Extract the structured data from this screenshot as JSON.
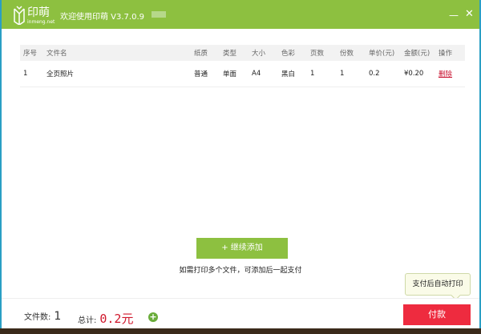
{
  "window": {
    "logo_text": "印萌",
    "logo_sub": "inmeng.net",
    "title": "欢迎使用印萌 V3.7.0.9",
    "minimize": "—",
    "close": "✕"
  },
  "table": {
    "headers": [
      "序号",
      "文件名",
      "纸质",
      "类型",
      "大小",
      "色彩",
      "页数",
      "份数",
      "单价(元)",
      "金额(元)",
      "操作"
    ],
    "rows": [
      {
        "index": "1",
        "name": "全页照片",
        "paper": "普通",
        "type": "单面",
        "size": "A4",
        "color": "黑白",
        "pages": "1",
        "copies": "1",
        "unit_price": "0.2",
        "amount": "¥0.20",
        "action": "删除"
      }
    ]
  },
  "add_button": "+ 继续添加",
  "note": "如需打印多个文件，可添加后一起支付",
  "tooltip": "支付后自动打印",
  "footer": {
    "file_count_label": "文件数:",
    "file_count": "1",
    "total_label": "总计:",
    "total": "0.2元",
    "plus": "+",
    "pay": "付款"
  },
  "colors": {
    "brand": "#8dc040",
    "pay": "#ee2b3f",
    "price": "#d0182c"
  }
}
